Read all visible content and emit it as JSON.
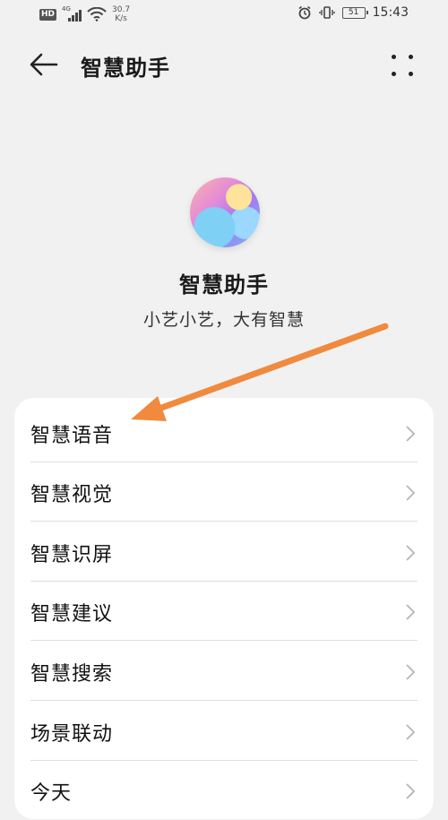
{
  "status_bar": {
    "hd": "HD",
    "network": "4G",
    "speed_value": "30.7",
    "speed_unit": "K/s",
    "battery": "51",
    "time": "15:43"
  },
  "header": {
    "title": "智慧助手",
    "back_icon": "arrow-left-icon",
    "more_icon": "more-vert-icon"
  },
  "hero": {
    "app_name": "智慧助手",
    "slogan": "小艺小艺，大有智慧"
  },
  "menu": {
    "items": [
      {
        "label": "智慧语音"
      },
      {
        "label": "智慧视觉"
      },
      {
        "label": "智慧识屏"
      },
      {
        "label": "智慧建议"
      },
      {
        "label": "智慧搜索"
      },
      {
        "label": "场景联动"
      },
      {
        "label": "今天"
      }
    ]
  },
  "colors": {
    "background": "#f1f1f1",
    "card": "#ffffff",
    "annotation_arrow": "#f08a3e"
  }
}
